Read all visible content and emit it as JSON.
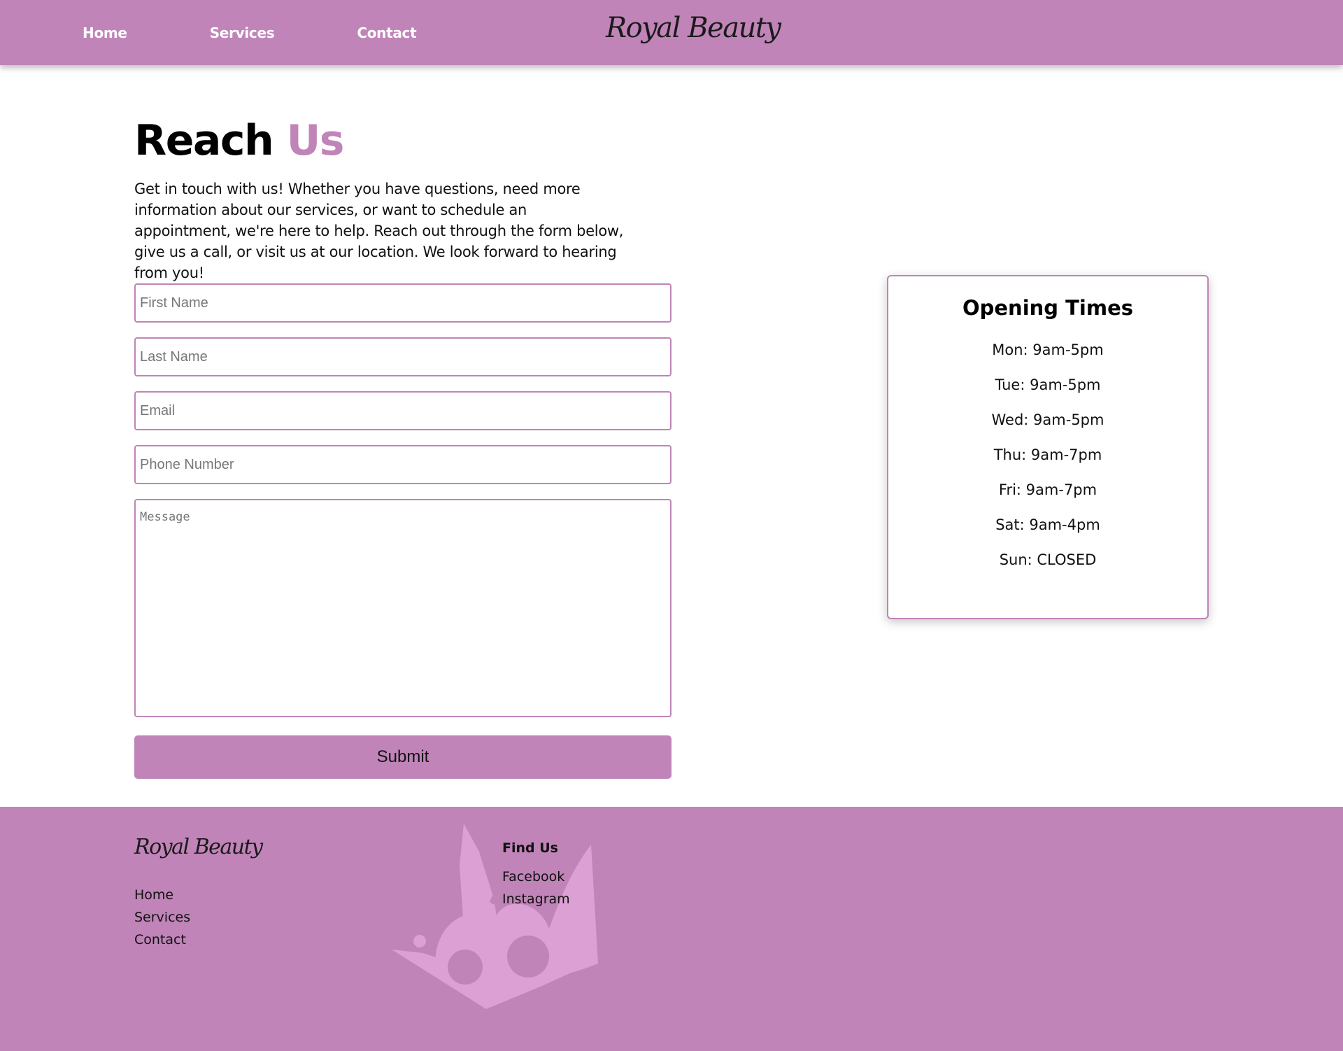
{
  "header": {
    "nav": [
      {
        "label": "Home"
      },
      {
        "label": "Services"
      },
      {
        "label": "Contact"
      }
    ],
    "logo": "Royal Beauty"
  },
  "main": {
    "title_part1": "Reach",
    "title_part2": "Us",
    "intro": "Get in touch with us! Whether you have questions, need more information about our services, or want to schedule an appointment, we're here to help. Reach out through the form below, give us a call, or visit us at our location. We look forward to hearing from you!",
    "form": {
      "first_name_placeholder": "First Name",
      "last_name_placeholder": "Last Name",
      "email_placeholder": "Email",
      "phone_placeholder": "Phone Number",
      "message_placeholder": "Message",
      "submit_label": "Submit"
    }
  },
  "hours": {
    "title": "Opening Times",
    "items": [
      "Mon: 9am-5pm",
      "Tue: 9am-5pm",
      "Wed: 9am-5pm",
      "Thu: 9am-7pm",
      "Fri: 9am-7pm",
      "Sat: 9am-4pm",
      "Sun: CLOSED"
    ]
  },
  "footer": {
    "logo": "Royal Beauty",
    "links": [
      "Home",
      "Services",
      "Contact"
    ],
    "find_us_title": "Find Us",
    "social": [
      "Facebook",
      "Instagram"
    ],
    "crown_icon": "crown-icon"
  },
  "colors": {
    "accent": "#c084b8",
    "crown": "#dda0d5"
  }
}
